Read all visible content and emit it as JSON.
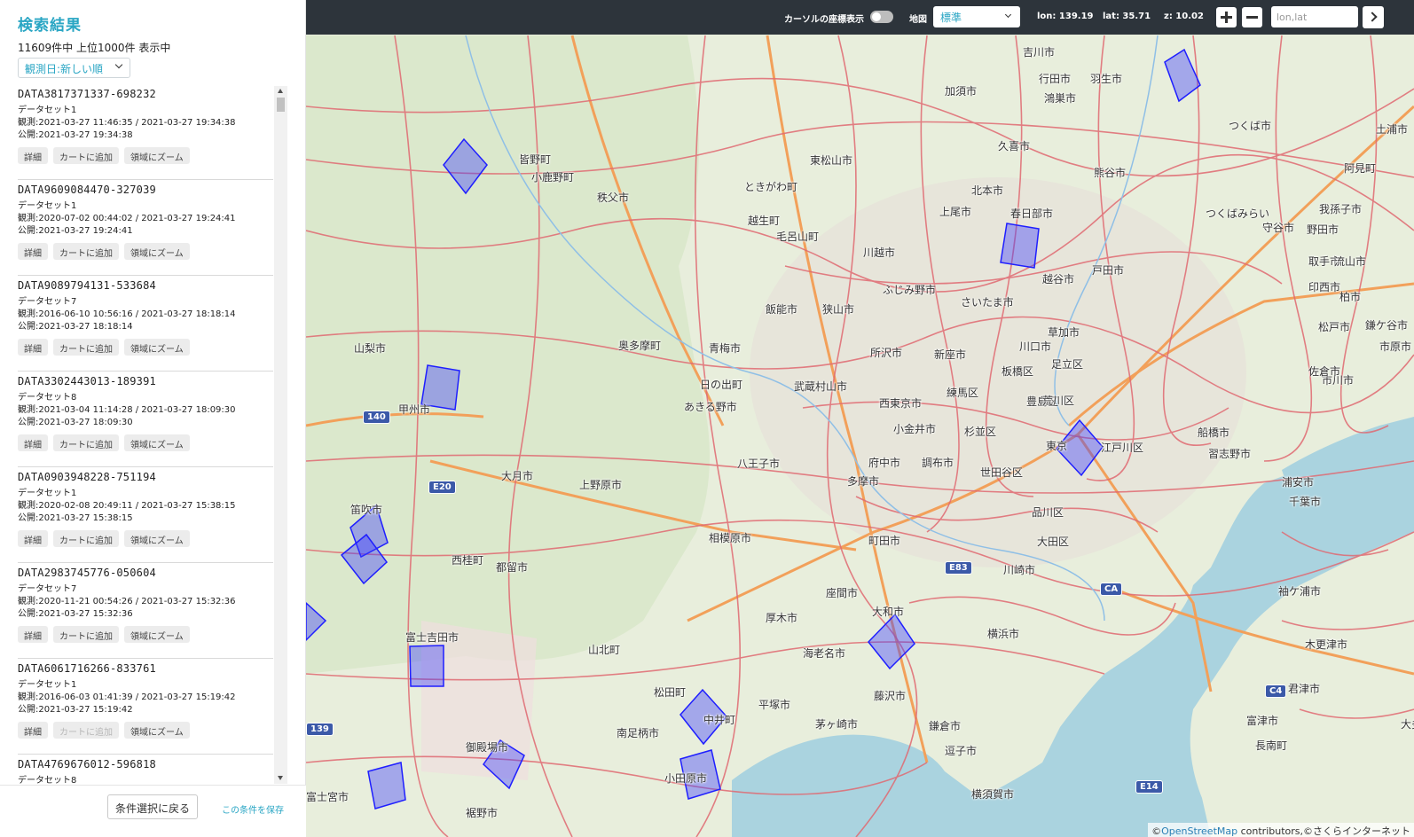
{
  "sidebar": {
    "title": "検索結果",
    "count_text": "11609件中 上位1000件 表示中",
    "sort": {
      "selected": "観測日:新しい順"
    },
    "items": [
      {
        "id": "DATA3817371337-698232",
        "dataset": "データセット1",
        "observed": "観測:2021-03-27 11:46:35 / 2021-03-27 19:34:38",
        "published": "公開:2021-03-27 19:34:38"
      },
      {
        "id": "DATA9609084470-327039",
        "dataset": "データセット1",
        "observed": "観測:2020-07-02 00:44:02 / 2021-03-27 19:24:41",
        "published": "公開:2021-03-27 19:24:41"
      },
      {
        "id": "DATA9089794131-533684",
        "dataset": "データセット7",
        "observed": "観測:2016-06-10 10:56:16 / 2021-03-27 18:18:14",
        "published": "公開:2021-03-27 18:18:14"
      },
      {
        "id": "DATA3302443013-189391",
        "dataset": "データセット8",
        "observed": "観測:2021-03-04 11:14:28 / 2021-03-27 18:09:30",
        "published": "公開:2021-03-27 18:09:30"
      },
      {
        "id": "DATA0903948228-751194",
        "dataset": "データセット1",
        "observed": "観測:2020-02-08 20:49:11 / 2021-03-27 15:38:15",
        "published": "公開:2021-03-27 15:38:15"
      },
      {
        "id": "DATA2983745776-050604",
        "dataset": "データセット7",
        "observed": "観測:2020-11-21 00:54:26 / 2021-03-27 15:32:36",
        "published": "公開:2021-03-27 15:32:36"
      },
      {
        "id": "DATA6061716266-833761",
        "dataset": "データセット1",
        "observed": "観測:2016-06-03 01:41:39 / 2021-03-27 15:19:42",
        "published": "公開:2021-03-27 15:19:42"
      },
      {
        "id": "DATA4769676012-596818",
        "dataset": "データセット8",
        "observed": "",
        "published": ""
      }
    ],
    "buttons": {
      "detail": "詳細",
      "add_cart": "カートに追加",
      "zoom": "領域にズーム"
    },
    "footer": {
      "back": "条件選択に戻る",
      "save": "この条件を保存"
    }
  },
  "toolbar": {
    "cursor_label": "カーソルの座標表示",
    "cursor_toggle_on": false,
    "map_label": "地図",
    "map_type": "標準",
    "lon_text": "lon: 139.19",
    "lat_text": "lat: 35.71",
    "zoom_text": "z: 10.02",
    "coord_placeholder": "lon,lat"
  },
  "map": {
    "attribution_prefix": "©",
    "attribution_link": "OpenStreetMap",
    "attribution_suffix": " contributors,©さくらインターネット",
    "footprint_color": "#3b3bff",
    "labels": [
      "吉川市",
      "加須市",
      "行田市",
      "羽生市",
      "久喜市",
      "鴻巣市",
      "東松山市",
      "ときがわ町",
      "熊谷市",
      "北本市",
      "越生町",
      "毛呂山町",
      "上尾市",
      "春日部市",
      "川越市",
      "ふじみ野市",
      "さいたま市",
      "越谷市",
      "飯能市",
      "狭山市",
      "所沢市",
      "新座市",
      "戸田市",
      "川口市",
      "草加市",
      "青梅市",
      "練馬区",
      "板橋区",
      "足立区",
      "奥多摩町",
      "あきる野市",
      "日の出町",
      "武蔵村山市",
      "西東京市",
      "杉並区",
      "豊島区",
      "荒川区",
      "小金井市",
      "府中市",
      "調布市",
      "世田谷区",
      "八王子市",
      "多摩市",
      "東京",
      "江戸川区",
      "品川区",
      "大田区",
      "町田市",
      "相模原市",
      "川崎市",
      "厚木市",
      "座間市",
      "大和市",
      "海老名市",
      "藤沢市",
      "横浜市",
      "鎌倉市",
      "茅ヶ崎市",
      "平塚市",
      "逗子市",
      "横須賀市",
      "松田町",
      "小田原市",
      "南足柄市",
      "中井町",
      "大月市",
      "都留市",
      "西桂町",
      "上野原市",
      "山梨市",
      "甲州市",
      "笛吹市",
      "富士吉田市",
      "山北町",
      "御殿場市",
      "裾野市",
      "富士宮市",
      "秩父市",
      "皆野町",
      "小鹿野町",
      "取手市",
      "柏市",
      "松戸市",
      "市川市",
      "船橋市",
      "習志野市",
      "千葉市",
      "浦安市",
      "つくば市",
      "つくばみらい",
      "土浦市",
      "阿見町",
      "守谷市",
      "野田市",
      "流山市",
      "我孫子市",
      "印西市",
      "鎌ケ谷市",
      "佐倉市",
      "市原市",
      "袖ケ浦市",
      "木更津市",
      "君津市",
      "富津市",
      "長南町",
      "大多喜町"
    ],
    "shields": [
      "140",
      "E20",
      "E83",
      "CA",
      "C4",
      "E14",
      "139"
    ]
  }
}
